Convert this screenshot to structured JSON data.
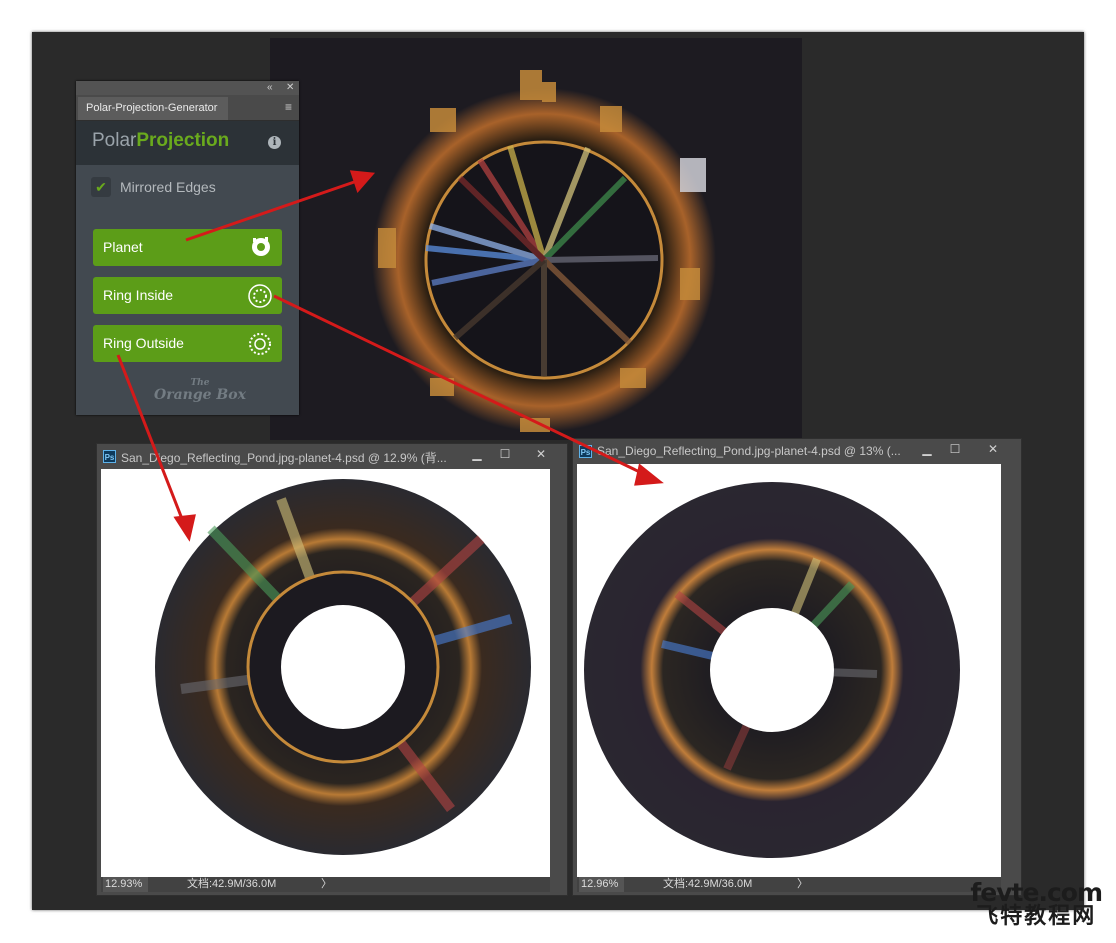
{
  "panel": {
    "collapse_icon": "double-chevron-left",
    "close_icon": "close",
    "tab_label": "Polar-Projection-Generator",
    "menu_icon": "hamburger-menu",
    "brand_light": "Polar",
    "brand_bold": "Projection",
    "info_icon": "info",
    "mirrored_edges": {
      "label": "Mirrored Edges",
      "checked": true
    },
    "buttons": [
      {
        "label": "Planet",
        "icon": "planet-icon"
      },
      {
        "label": "Ring Inside",
        "icon": "ring-inside-icon"
      },
      {
        "label": "Ring Outside",
        "icon": "ring-outside-icon"
      }
    ],
    "logo_small": "The",
    "logo_big": "Orange Box",
    "accent_color": "#5c9d18"
  },
  "doc_left": {
    "badge": "Ps",
    "title": "San_Diego_Reflecting_Pond.jpg-planet-4.psd @ 12.9% (背...",
    "zoom": "12.93%",
    "doc_info": "文档:42.9M/36.0M",
    "chevron": "〉"
  },
  "doc_right": {
    "badge": "Ps",
    "title": "San_Diego_Reflecting_Pond.jpg-planet-4.psd @ 13% (...",
    "zoom": "12.96%",
    "doc_info": "文档:42.9M/36.0M",
    "chevron": "〉"
  },
  "watermark": {
    "line1": "fevte.com",
    "line2": "飞特教程网"
  },
  "arrow_color": "#d41a1a"
}
